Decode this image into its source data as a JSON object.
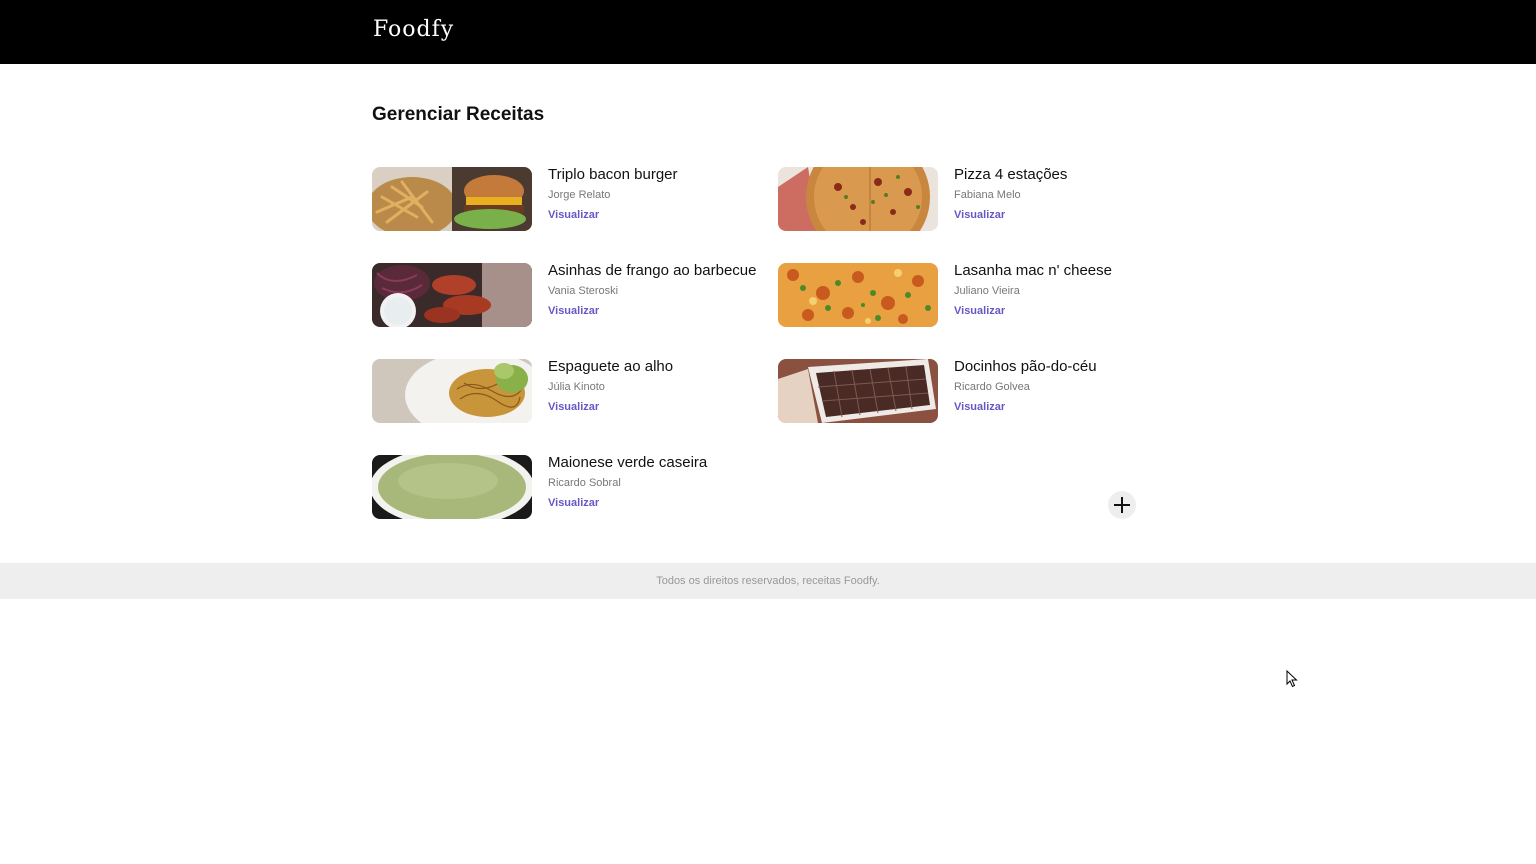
{
  "header": {
    "logo": "Foodfy"
  },
  "main": {
    "title": "Gerenciar Receitas",
    "link_label": "Visualizar",
    "recipes": [
      {
        "title": "Triplo bacon burger",
        "author": "Jorge Relato"
      },
      {
        "title": "Pizza 4 estações",
        "author": "Fabiana Melo"
      },
      {
        "title": "Asinhas de frango ao barbecue",
        "author": "Vania Steroski"
      },
      {
        "title": "Lasanha mac n' cheese",
        "author": "Juliano Vieira"
      },
      {
        "title": "Espaguete ao alho",
        "author": "Júlia Kinoto"
      },
      {
        "title": "Docinhos pão-do-céu",
        "author": "Ricardo Golvea"
      },
      {
        "title": "Maionese verde caseira",
        "author": "Ricardo Sobral"
      }
    ],
    "add_icon": "plus-icon"
  },
  "footer": {
    "text": "Todos os direitos reservados, receitas Foodfy."
  },
  "colors": {
    "header_bg": "#000000",
    "link": "#6558c3",
    "footer_bg": "#eeeeee"
  }
}
